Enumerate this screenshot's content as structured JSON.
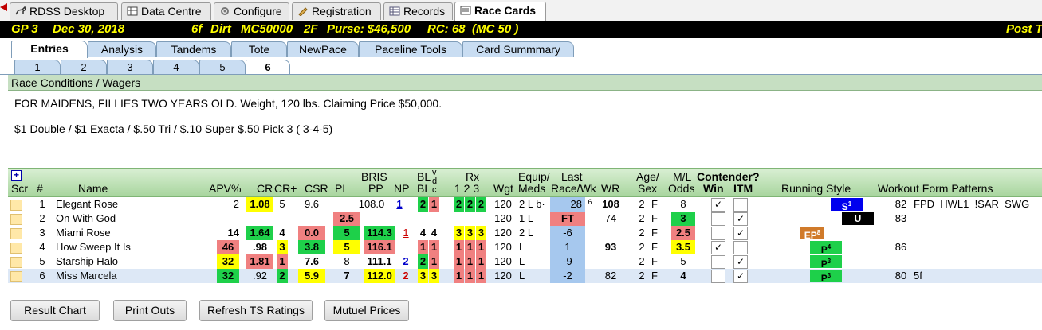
{
  "top_tabs": [
    {
      "label": "RDSS Desktop",
      "icon": "horse-icon"
    },
    {
      "label": "Data Centre",
      "icon": "database-icon"
    },
    {
      "label": "Configure",
      "icon": "gear-icon"
    },
    {
      "label": "Registration",
      "icon": "registration-icon"
    },
    {
      "label": "Records",
      "icon": "grid-icon"
    },
    {
      "label": "Race Cards",
      "icon": "card-icon",
      "selected": true
    }
  ],
  "race_header": {
    "race": "GP 3",
    "date": "Dec 30, 2018",
    "distance": "6f",
    "surface": "Dirt",
    "race_type": "MC50000",
    "age_sex": "2F",
    "purse": "Purse: $46,500",
    "rc": "RC: 68",
    "mc": "(MC 50 )",
    "post": "Post T"
  },
  "sub_tabs": [
    "Entries",
    "Analysis",
    "Tandems",
    "Tote",
    "NewPace",
    "Paceline Tools",
    "Card Summmary"
  ],
  "race_tabs": [
    "1",
    "2",
    "3",
    "4",
    "5",
    "6"
  ],
  "selected_race_tab": "6",
  "conditions": {
    "header": "Race Conditions / Wagers",
    "text": "FOR MAIDENS, FILLIES TWO YEARS OLD. Weight, 120 lbs. Claiming Price $50,000.",
    "wagers": "$1 Double / $1 Exacta / $.50 Tri / $.10 Super $.50 Pick 3 ( 3-4-5)"
  },
  "grid_headers": {
    "plus": "+",
    "scr": "Scr",
    "num": "#",
    "name": "Name",
    "apv": "APV%",
    "cr": "CR",
    "crplus": "CR+",
    "csr": "CSR",
    "pl": "PL",
    "bris1": "BRIS",
    "bris2": "PP",
    "np": "NP",
    "bl1": "BL",
    "bl2": "BL",
    "v": "v",
    "d": "d",
    "c": "c",
    "rx1": "Rx",
    "rx2": "1  2  3",
    "wgt": "Wgt",
    "equip1": "Equip/",
    "equip2": "Meds",
    "last1": "Last",
    "last2": "Race/Wk",
    "wr": "WR",
    "age1": "Age/",
    "age2": "Sex",
    "ml1": "M/L",
    "ml2": "Odds",
    "contender": "Contender?",
    "win": "Win",
    "itm": "ITM",
    "running_style": "Running Style",
    "workout": "Workout Form Patterns"
  },
  "horses": [
    {
      "num": "1",
      "name": "Elegant Rose",
      "apv": "2",
      "cr": "1.08",
      "crplus": "5",
      "csr": "9.6",
      "pl": "",
      "bris": "108.0",
      "np": "1",
      "bl1": "2",
      "bl2": "1",
      "rx": [
        "2",
        "2",
        "2"
      ],
      "wgt": "120",
      "equip": "2 L b·",
      "last": "28",
      "last_sup": "6",
      "wr": "108",
      "age": "2",
      "sex": "F",
      "ml": "8",
      "win": true,
      "itm": false,
      "style": "S",
      "style_sup": "1",
      "wf": "82",
      "patterns": "FPD  HWL1  !SAR  SWG"
    },
    {
      "num": "2",
      "name": "On With God",
      "apv": "",
      "cr": "",
      "crplus": "",
      "csr": "",
      "pl": "2.5",
      "bris": "",
      "np": "",
      "bl1": "",
      "bl2": "",
      "rx": [
        "",
        "",
        ""
      ],
      "wgt": "120",
      "equip": "1 L",
      "last": "FT",
      "last_sup": "",
      "wr": "74",
      "age": "2",
      "sex": "F",
      "ml": "3",
      "win": false,
      "itm": true,
      "style": "U",
      "style_sup": "",
      "wf": "83",
      "patterns": ""
    },
    {
      "num": "3",
      "name": "Miami Rose",
      "apv": "14",
      "cr": "1.64",
      "crplus": "4",
      "csr": "0.0",
      "pl": "5",
      "bris": "114.3",
      "np": "1",
      "bl1": "4",
      "bl2": "4",
      "rx": [
        "3",
        "3",
        "3"
      ],
      "wgt": "120",
      "equip": "2 L",
      "last": "-6",
      "last_sup": "",
      "wr": "",
      "age": "2",
      "sex": "F",
      "ml": "2.5",
      "win": false,
      "itm": true,
      "style": "EP",
      "style_sup": "8",
      "wf": "",
      "patterns": ""
    },
    {
      "num": "4",
      "name": "How Sweep It Is",
      "apv": "46",
      "cr": ".98",
      "crplus": "3",
      "csr": "3.8",
      "pl": "5",
      "bris": "116.1",
      "np": "",
      "bl1": "1",
      "bl2": "1",
      "rx": [
        "1",
        "1",
        "1"
      ],
      "wgt": "120",
      "equip": "L",
      "last": "1",
      "last_sup": "",
      "wr": "93",
      "age": "2",
      "sex": "F",
      "ml": "3.5",
      "win": true,
      "itm": false,
      "style": "P",
      "style_sup": "4",
      "wf": "86",
      "patterns": ""
    },
    {
      "num": "5",
      "name": "Starship Halo",
      "apv": "32",
      "cr": "1.81",
      "crplus": "1",
      "csr": "7.6",
      "pl": "8",
      "bris": "111.1",
      "np": "2",
      "bl1": "2",
      "bl2": "1",
      "rx": [
        "1",
        "1",
        "1"
      ],
      "wgt": "120",
      "equip": "L",
      "last": "-9",
      "last_sup": "",
      "wr": "",
      "age": "2",
      "sex": "F",
      "ml": "5",
      "win": false,
      "itm": true,
      "style": "P",
      "style_sup": "3",
      "wf": "",
      "patterns": ""
    },
    {
      "num": "6",
      "name": "Miss Marcela",
      "apv": "32",
      "cr": ".92",
      "crplus": "2",
      "csr": "5.9",
      "pl": "7",
      "bris": "112.0",
      "np": "2",
      "bl1": "3",
      "bl2": "3",
      "rx": [
        "1",
        "1",
        "1"
      ],
      "wgt": "120",
      "equip": "L",
      "last": "-2",
      "last_sup": "",
      "wr": "82",
      "age": "2",
      "sex": "F",
      "ml": "4",
      "win": false,
      "itm": true,
      "style": "P",
      "style_sup": "3",
      "wf": "80",
      "patterns": "5f"
    }
  ],
  "buttons": [
    "Result Chart",
    "Print Outs",
    "Refresh TS Ratings",
    "Mutuel Prices"
  ],
  "colors": {
    "green": "#1ed04a",
    "yellow": "#ffff00",
    "red": "#f08080",
    "blue": "#a6c8ee",
    "header_yellow": "#ffff00"
  }
}
